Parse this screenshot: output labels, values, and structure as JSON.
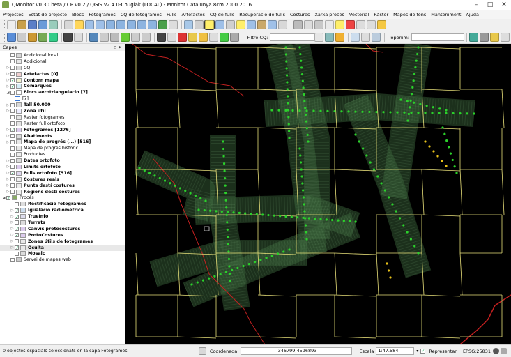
{
  "window": {
    "title": "QMonitor v0.30 beta / CP v0.2 / QGIS v2.4.0-Chugiak (LOCAL) - Monitor Catalunya 8cm 2000 2016"
  },
  "menu": [
    "Projectes",
    "Estat de projecte",
    "Blocs",
    "Fotogrames",
    "CQ de fotogrames",
    "Fulls",
    "Artefactes",
    "CQ de fulls",
    "Recuperació de fulls",
    "Costures",
    "Xarxa procés",
    "Vectorial",
    "Ràster",
    "Mapes de fons",
    "Manteniment",
    "Ajuda"
  ],
  "toolbar2": {
    "filter_label": "Filtre CQ:",
    "filter_value": "",
    "toponym_label": "Topònim:",
    "toponym_value": ""
  },
  "layers_panel": {
    "title": "Capes",
    "layers": [
      {
        "label": "Addicional local",
        "checked": false,
        "bold": false,
        "arrow": "",
        "indent": 1
      },
      {
        "label": "Addicional",
        "checked": false,
        "bold": false,
        "arrow": "",
        "indent": 1
      },
      {
        "label": "CQ",
        "checked": false,
        "bold": false,
        "arrow": "▷",
        "indent": 1
      },
      {
        "label": "Artefactes [0]",
        "checked": false,
        "bold": true,
        "arrow": "▷",
        "indent": 1
      },
      {
        "label": "Contorn mapa",
        "checked": true,
        "bold": true,
        "arrow": "▷",
        "indent": 1
      },
      {
        "label": "Comarques",
        "checked": true,
        "bold": true,
        "arrow": "▷",
        "indent": 1
      },
      {
        "label": "Blocs aerotriangulacio [7]",
        "checked": false,
        "bold": true,
        "arrow": "◢",
        "indent": 1
      },
      {
        "label": "[7]",
        "checked": false,
        "bold": false,
        "arrow": "",
        "indent": 2,
        "swatch": true
      },
      {
        "label": "Tall 50.000",
        "checked": false,
        "bold": true,
        "arrow": "▷",
        "indent": 1
      },
      {
        "label": "Zona útil",
        "checked": false,
        "bold": true,
        "arrow": "▷",
        "indent": 1
      },
      {
        "label": "Raster fotogrames",
        "checked": false,
        "bold": false,
        "arrow": "",
        "indent": 1
      },
      {
        "label": "Raster full ortofoto",
        "checked": false,
        "bold": false,
        "arrow": "",
        "indent": 1
      },
      {
        "label": "Fotogrames [1276]",
        "checked": true,
        "bold": true,
        "arrow": "▷",
        "indent": 1
      },
      {
        "label": "Abatiments",
        "checked": false,
        "bold": true,
        "arrow": "▷",
        "indent": 1
      },
      {
        "label": "Mapa de progrés (...) [516]",
        "checked": false,
        "bold": true,
        "arrow": "▷",
        "indent": 1
      },
      {
        "label": "Mapa de progrés històric",
        "checked": false,
        "bold": false,
        "arrow": "",
        "indent": 1
      },
      {
        "label": "Productes",
        "checked": false,
        "bold": false,
        "arrow": "",
        "indent": 1
      },
      {
        "label": "Dates ortofoto",
        "checked": false,
        "bold": true,
        "arrow": "▷",
        "indent": 1
      },
      {
        "label": "Límits ortofoto",
        "checked": false,
        "bold": true,
        "arrow": "▷",
        "indent": 1
      },
      {
        "label": "Fulls ortofoto [516]",
        "checked": true,
        "bold": true,
        "arrow": "▷",
        "indent": 1
      },
      {
        "label": "Costures reals",
        "checked": false,
        "bold": true,
        "arrow": "▷",
        "indent": 1
      },
      {
        "label": "Punts destí costures",
        "checked": false,
        "bold": true,
        "arrow": "▷",
        "indent": 1
      },
      {
        "label": "Regions destí costures",
        "checked": false,
        "bold": true,
        "arrow": "▷",
        "indent": 1
      },
      {
        "label": "Procés",
        "checked": true,
        "bold": false,
        "arrow": "◢",
        "indent": 0,
        "group": true
      },
      {
        "label": "Rectificacio fotogrames",
        "checked": false,
        "bold": true,
        "arrow": "",
        "indent": 2
      },
      {
        "label": "Igualació radiomètrica",
        "checked": true,
        "bold": true,
        "arrow": "▷",
        "indent": 2
      },
      {
        "label": "TrueInfo",
        "checked": true,
        "bold": true,
        "arrow": "▷",
        "indent": 2
      },
      {
        "label": "Terrats",
        "checked": false,
        "bold": true,
        "arrow": "▷",
        "indent": 2
      },
      {
        "label": "Canvis protocostures",
        "checked": true,
        "bold": true,
        "arrow": "▷",
        "indent": 2
      },
      {
        "label": "ProtoCostures",
        "checked": true,
        "bold": true,
        "arrow": "▷",
        "indent": 2
      },
      {
        "label": "Zones útils de fotogrames",
        "checked": false,
        "bold": true,
        "arrow": "▷",
        "indent": 2
      },
      {
        "label": "Oculta",
        "checked": true,
        "bold": true,
        "arrow": "▷",
        "indent": 2,
        "selected": true
      },
      {
        "label": "Mosaic",
        "checked": false,
        "bold": true,
        "arrow": "",
        "indent": 2
      },
      {
        "label": "Servei de mapes web",
        "checked": false,
        "bold": false,
        "arrow": "",
        "indent": 1
      }
    ]
  },
  "status": {
    "message": "0 objectes espacials seleccionats en la capa Fotogrames.",
    "coord_label": "Coordenada:",
    "coord_value": "346799,4596893",
    "scale_label": "Escala",
    "scale_value": "1:47.584",
    "render_label": "Representar",
    "crs": "EPSG:25831"
  },
  "colors": {
    "grid": "#e8e07a",
    "points": "#2bd12b",
    "highlight": "#e8c21a",
    "border": "#c42020",
    "footprint": "#3f6a3f"
  }
}
